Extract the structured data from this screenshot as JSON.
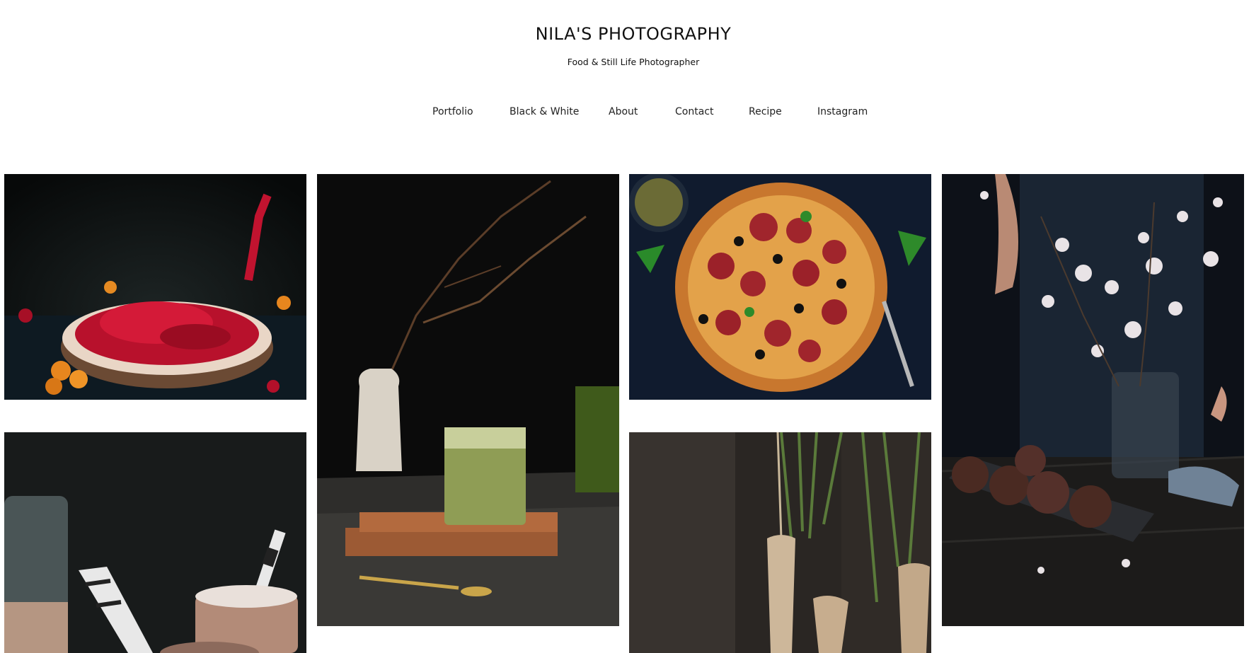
{
  "site": {
    "title": "NILA'S PHOTOGRAPHY",
    "subtitle": "Food & Still Life Photographer"
  },
  "nav": {
    "items": [
      {
        "label": "Portfolio"
      },
      {
        "label": "Black & White"
      },
      {
        "label": "About"
      },
      {
        "label": "Contact"
      },
      {
        "label": "Recipe"
      },
      {
        "label": "Instagram"
      }
    ]
  },
  "gallery": {
    "photos": [
      {
        "subject": "red currants on wooden board"
      },
      {
        "subject": "matcha latte with branch in vase"
      },
      {
        "subject": "pepperoni pizza with olives"
      },
      {
        "subject": "cherry blossoms with chocolate muffins"
      },
      {
        "subject": "hot chocolate drinks with straws"
      },
      {
        "subject": "parsnips with green stems"
      }
    ]
  },
  "colors": {
    "background": "#ffffff",
    "text": "#111111"
  }
}
